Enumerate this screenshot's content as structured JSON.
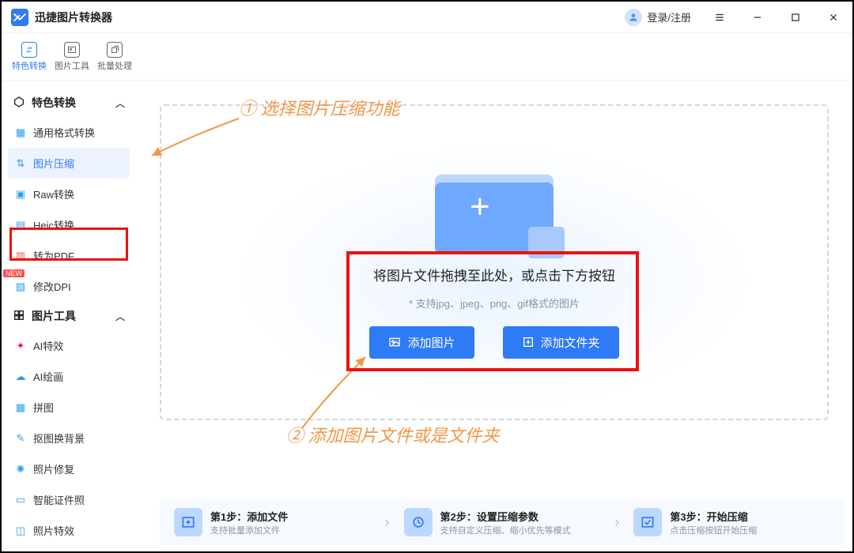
{
  "titlebar": {
    "app_name": "迅捷图片转换器",
    "login_label": "登录/注册"
  },
  "toptabs": [
    {
      "label": "特色转换"
    },
    {
      "label": "图片工具"
    },
    {
      "label": "批量处理"
    }
  ],
  "sidebar": {
    "group1": {
      "title": "特色转换"
    },
    "items1": [
      {
        "label": "通用格式转换"
      },
      {
        "label": "图片压缩"
      },
      {
        "label": "Raw转换"
      },
      {
        "label": "Heic转换"
      },
      {
        "label": "转为PDF"
      },
      {
        "label": "修改DPI",
        "badge": "NEW"
      }
    ],
    "group2": {
      "title": "图片工具"
    },
    "items2": [
      {
        "label": "AI特效"
      },
      {
        "label": "AI绘画"
      },
      {
        "label": "拼图"
      },
      {
        "label": "抠图换背景"
      },
      {
        "label": "照片修复"
      },
      {
        "label": "智能证件照"
      },
      {
        "label": "照片特效"
      }
    ]
  },
  "dropzone": {
    "title": "将图片文件拖拽至此处，或点击下方按钮",
    "subtitle": "* 支持jpg、jpeg、png、gif格式的图片",
    "add_image_btn": "添加图片",
    "add_folder_btn": "添加文件夹"
  },
  "annotations": {
    "step1": "① 选择图片压缩功能",
    "step2": "② 添加图片文件或是文件夹"
  },
  "steps": [
    {
      "title": "第1步：添加文件",
      "sub": "支持批量添加文件"
    },
    {
      "title": "第2步：设置压缩参数",
      "sub": "支持自定义压缩、缩小优先等模式"
    },
    {
      "title": "第3步：开始压缩",
      "sub": "点击压缩按钮开始压缩"
    }
  ]
}
